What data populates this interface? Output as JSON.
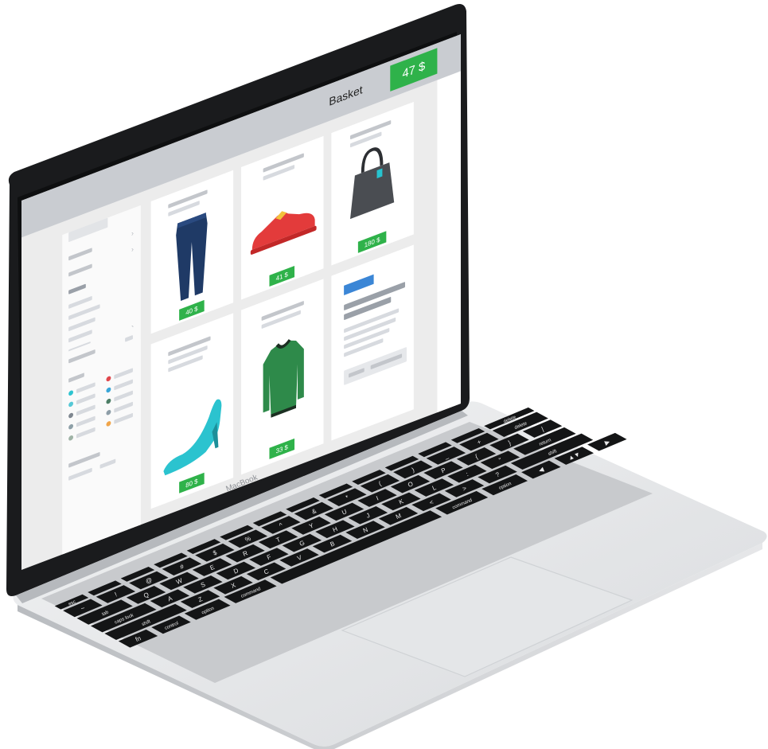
{
  "header": {
    "basket_label": "Basket",
    "basket_total": "47 $"
  },
  "laptop": {
    "brand": "MacBook"
  },
  "products": [
    {
      "name": "jeans",
      "price": "40 $"
    },
    {
      "name": "sneaker",
      "price": "41 $"
    },
    {
      "name": "handbag",
      "price": "180 $"
    },
    {
      "name": "high-heel",
      "price": "80 $"
    },
    {
      "name": "sweater",
      "price": "33 $"
    }
  ],
  "filter_colors": [
    "#2ec4d0",
    "#e0474c",
    "#56c8d6",
    "#3aa6d8",
    "#7f8790",
    "#4d7e66",
    "#8ea0a8",
    "#8e9ea8",
    "#9fb3a6",
    "#f0a54a"
  ],
  "keyboard": {
    "rows": [
      [
        "esc",
        "",
        "",
        "",
        "",
        "",
        "",
        "",
        "",
        "",
        "",
        "",
        "",
        "delete"
      ],
      [
        "~",
        "!",
        "@",
        "#",
        "$",
        "%",
        "^",
        "&",
        "*",
        "(",
        ")",
        "_",
        "+",
        "delete"
      ],
      [
        "tab",
        "Q",
        "W",
        "E",
        "R",
        "T",
        "Y",
        "U",
        "I",
        "O",
        "P",
        "{",
        "}",
        "|"
      ],
      [
        "caps lock",
        "A",
        "S",
        "D",
        "F",
        "G",
        "H",
        "J",
        "K",
        "L",
        ":",
        "\"",
        "return"
      ],
      [
        "shift",
        "Z",
        "X",
        "C",
        "V",
        "B",
        "N",
        "M",
        "<",
        ">",
        "?",
        "shift"
      ],
      [
        "fn",
        "control",
        "option",
        "command",
        "",
        "command",
        "option",
        "◀",
        "▲▼",
        "▶"
      ]
    ]
  },
  "colors": {
    "accent_green": "#2fb24a",
    "accent_blue": "#3b86d6",
    "topbar": "#c9ccd1"
  }
}
